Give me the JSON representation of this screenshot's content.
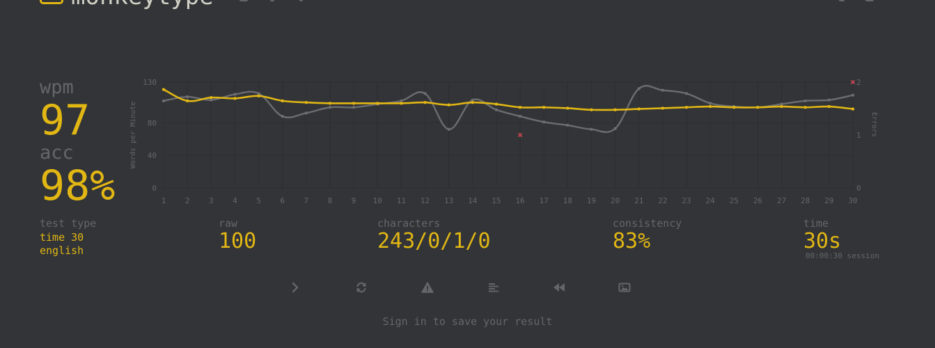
{
  "app": {
    "logo_text": "monkeytype"
  },
  "result": {
    "wpm_label": "wpm",
    "wpm_value": "97",
    "acc_label": "acc",
    "acc_value": "98%",
    "test_type_label": "test type",
    "test_type_mode": "time 30",
    "test_type_language": "english",
    "raw_label": "raw",
    "raw_value": "100",
    "characters_label": "characters",
    "characters_value": "243/0/1/0",
    "consistency_label": "consistency",
    "consistency_value": "83%",
    "time_label": "time",
    "time_value": "30s",
    "session_note": "00:00:30 session"
  },
  "actions": [
    {
      "name": "next-test-button",
      "icon": "chevron-right-icon"
    },
    {
      "name": "restart-test-button",
      "icon": "refresh-icon"
    },
    {
      "name": "practice-mistakes-button",
      "icon": "warning-icon"
    },
    {
      "name": "word-history-button",
      "icon": "align-left-icon"
    },
    {
      "name": "watch-replay-button",
      "icon": "backward-icon"
    },
    {
      "name": "save-screenshot-button",
      "icon": "image-icon"
    }
  ],
  "signin_text": "Sign in to save your result",
  "colors": {
    "background": "#323437",
    "main": "#e2b714",
    "sub": "#646669",
    "text": "#d1d0c5",
    "error": "#ca4754",
    "raw_line": "#6b6d70",
    "grid": "#2c2e31"
  },
  "chart_data": {
    "type": "line",
    "ylabel": "Words per Minute",
    "y2label": "Errors",
    "ylim": [
      0,
      130
    ],
    "y_ticks": [
      "0",
      "40",
      "80",
      "130"
    ],
    "y2lim": [
      0,
      2
    ],
    "y2_ticks": [
      "0",
      "1",
      "2"
    ],
    "x": [
      1,
      2,
      3,
      4,
      5,
      6,
      7,
      8,
      9,
      10,
      11,
      12,
      13,
      14,
      15,
      16,
      17,
      18,
      19,
      20,
      21,
      22,
      23,
      24,
      25,
      26,
      27,
      28,
      29,
      30
    ],
    "series": [
      {
        "kind": "wpm",
        "color": "#e2b714",
        "values": [
          121,
          107,
          111,
          110,
          113,
          107,
          105,
          104,
          104,
          104,
          104,
          105,
          102,
          105,
          103,
          99,
          99,
          98,
          96,
          96,
          97,
          98,
          99,
          100,
          99,
          99,
          100,
          99,
          100,
          97
        ]
      },
      {
        "kind": "raw",
        "color": "#6b6d70",
        "values": [
          107,
          112,
          108,
          115,
          116,
          88,
          92,
          99,
          99,
          103,
          107,
          116,
          72,
          108,
          96,
          88,
          81,
          77,
          72,
          73,
          122,
          120,
          116,
          104,
          100,
          99,
          103,
          107,
          108,
          114
        ]
      },
      {
        "kind": "errors",
        "color": "#ca4754",
        "points": [
          [
            16,
            1
          ],
          [
            30,
            2
          ]
        ]
      }
    ]
  }
}
